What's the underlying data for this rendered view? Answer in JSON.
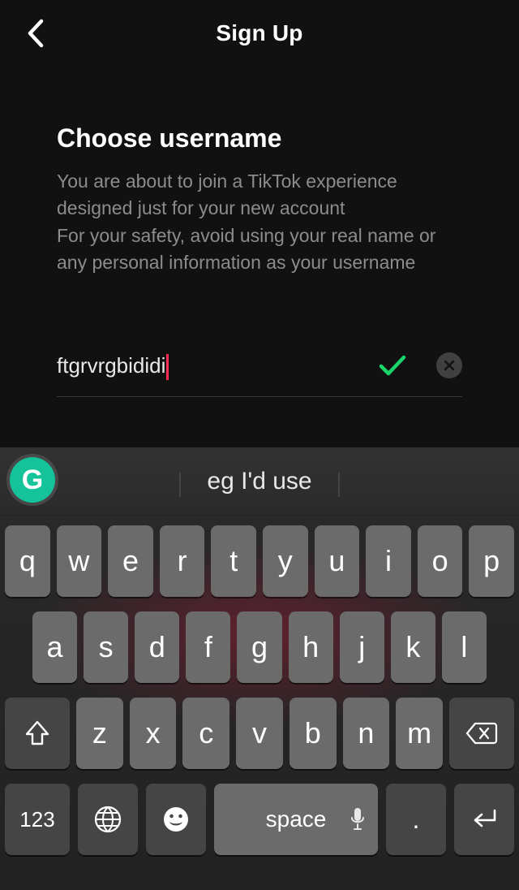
{
  "header": {
    "title": "Sign Up"
  },
  "main": {
    "heading": "Choose username",
    "description": "You are about to join a TikTok experience designed just for your new account\nFor your safety, avoid using your real name or any personal information as your username",
    "username_value": "ftgrvrgbididi"
  },
  "keyboard": {
    "grammarly_label": "G",
    "suggestion": "eg I'd use",
    "row1": [
      "q",
      "w",
      "e",
      "r",
      "t",
      "y",
      "u",
      "i",
      "o",
      "p"
    ],
    "row2": [
      "a",
      "s",
      "d",
      "f",
      "g",
      "h",
      "j",
      "k",
      "l"
    ],
    "row3": [
      "z",
      "x",
      "c",
      "v",
      "b",
      "n",
      "m"
    ],
    "numbers_label": "123",
    "space_label": "space",
    "period_label": "."
  }
}
